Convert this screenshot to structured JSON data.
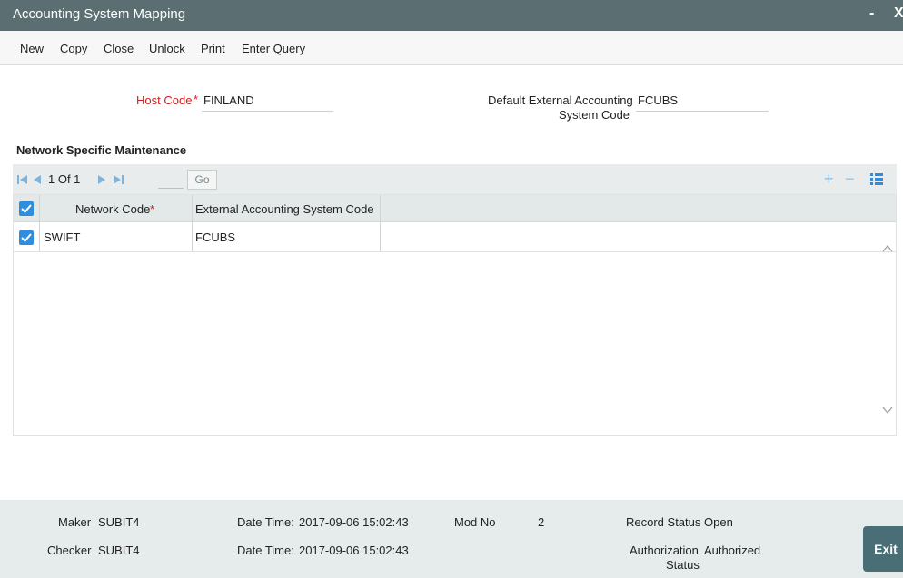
{
  "window": {
    "title": "Accounting System Mapping",
    "minimize": "-",
    "close": "X"
  },
  "menu": [
    "New",
    "Copy",
    "Close",
    "Unlock",
    "Print",
    "Enter Query"
  ],
  "form": {
    "host_code_label": "Host Code",
    "required_mark": "*",
    "host_code_value": "FINLAND",
    "default_ext_label_line1": "Default External Accounting",
    "default_ext_label_line2": "System Code",
    "default_ext_value": "FCUBS"
  },
  "section": {
    "title": "Network Specific Maintenance"
  },
  "pager": {
    "text": "1 Of 1",
    "go_label": "Go"
  },
  "grid": {
    "columns": {
      "network_code": "Network Code",
      "network_code_required": "*",
      "ext_system_code": "External Accounting System Code"
    },
    "rows": [
      {
        "network_code": "SWIFT",
        "ext_system_code": "FCUBS",
        "checked": true
      }
    ],
    "header_checked": true
  },
  "toolbar_icons": {
    "add": "+",
    "remove": "−"
  },
  "footer": {
    "maker_label": "Maker",
    "maker_value": "SUBIT4",
    "checker_label": "Checker",
    "checker_value": "SUBIT4",
    "datetime_label": "Date Time:",
    "maker_datetime": "2017-09-06 15:02:43",
    "checker_datetime": "2017-09-06 15:02:43",
    "mod_no_label": "Mod No",
    "mod_no_value": "2",
    "record_status_label": "Record Status",
    "record_status_value": "Open",
    "auth_status_label_line1": "Authorization",
    "auth_status_label_line2": "Status",
    "auth_status_value": "Authorized",
    "exit_label": "Exit"
  },
  "colors": {
    "titlebar": "#5b6e72",
    "accent": "#2f8de0",
    "required": "#d11f1f",
    "footer": "#e6ecec",
    "exit": "#4a6e75"
  }
}
